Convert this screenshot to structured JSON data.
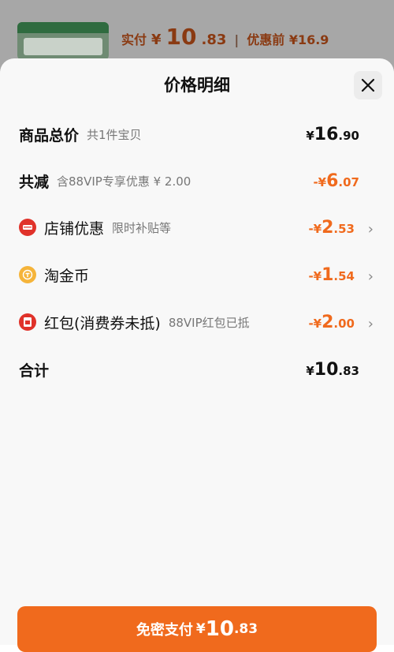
{
  "header": {
    "paid_label": "实付",
    "currency": "¥",
    "paid_int": "10",
    "paid_dec": ".83",
    "separator": "|",
    "before_label": "优惠前 ¥16.9"
  },
  "sheet": {
    "title": "价格明细",
    "rows": [
      {
        "label": "商品总价",
        "sub": "共1件宝贝",
        "cur": "¥",
        "int": "16",
        "dec": ".90"
      },
      {
        "label": "共减",
        "sub": "含88VIP专享优惠 ¥ 2.00",
        "cur": "-¥",
        "int": "6",
        "dec": ".07"
      },
      {
        "label": "店铺优惠",
        "sub": "限时补贴等",
        "cur": "-¥",
        "int": "2",
        "dec": ".53",
        "icon": "shop-icon"
      },
      {
        "label": "淘金币",
        "sub": "",
        "cur": "-¥",
        "int": "1",
        "dec": ".54",
        "icon": "coin-icon"
      },
      {
        "label": "红包(消费券未抵)",
        "sub": "88VIP红包已抵",
        "cur": "-¥",
        "int": "2",
        "dec": ".00",
        "icon": "red-packet-icon"
      },
      {
        "label": "合计",
        "sub": "",
        "cur": "¥",
        "int": "10",
        "dec": ".83"
      }
    ],
    "chevron": "›"
  },
  "pay_button": {
    "label": "免密支付",
    "cur": "¥",
    "int": "10",
    "dec": ".83"
  },
  "colors": {
    "accent": "#f06a1d",
    "red_icon": "#e0322a",
    "coin_icon": "#f5b43a"
  }
}
